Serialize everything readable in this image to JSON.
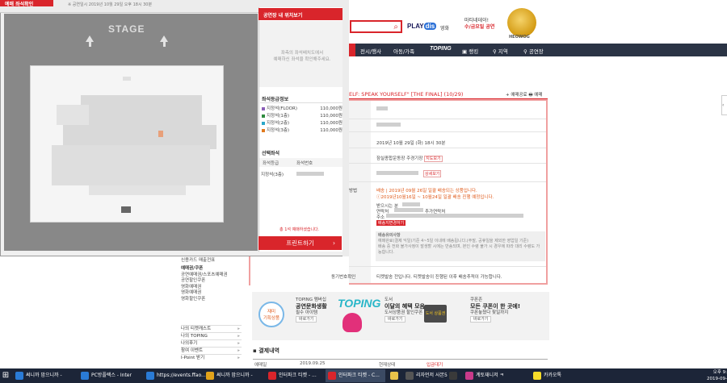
{
  "site": {
    "top_links": {
      "play": "PLAY",
      "play_badge": "dis",
      "movie": "영화"
    },
    "promo": {
      "line1": "마티네데이!",
      "line2": "수/금요일 공연"
    },
    "emblem_label": "HEOWOG",
    "nav": [
      "전시/행사",
      "아동/가족",
      "TOPING",
      "랭킹",
      "지역",
      "공연장"
    ],
    "show_title": "ELF: SPEAK YOURSELF\" [THE FINAL] (10/29)",
    "title_actions": "+ 예매공료  🖶 예매",
    "info": {
      "date": "2019년 10월 29일 (화)  18시 30분",
      "venue": "잠실종합운동장 주경기장",
      "venue_btn": "지도보기",
      "detail_btn": "상세보기",
      "delivery_label": "방법",
      "delivery_line1": "배송 | 2019년 09월 26일 일괄 배송되는 상품입니다.",
      "delivery_line2": "ⓘ2019년10월16일 ~ 10월24일 일괄 배송 진행 예정입니다.",
      "recv_label": "받으시는 분",
      "contact_label": "연락처",
      "extra_contact": "추가연락처",
      "address_label": "주소",
      "change_btn": "배송지변경하기",
      "note_title": "배송유의사항",
      "note_line1": "예매완료(결제 익일)기준 4~5일 이내에 배송됩니다.(주말, 공휴일을 제외한 영업일 기준)",
      "note_line2": "배송 중 전화 불가사정이 발생할 시에는 반송되며, 본인 수령 불가 시 경우에 따라 대리 수령도 가능합니다.",
      "ticket_label": "동기번호확인",
      "ticket_text": "티켓발송 전입니다. 티켓발송이 진행된 이후 배송추적이 가능합니다."
    },
    "sidebar_lower": {
      "items_a": [
        "현금영수증",
        "신용카드 매출전표"
      ],
      "coupon_head": "예매권/쿠폰",
      "coupons": [
        "공연예매권/스포츠예매권",
        "공연할인쿠폰",
        "영화예매권",
        "영화예매권",
        "영화할인쿠폰"
      ],
      "menu": [
        "나의 티켓캐스트",
        "나의 TOPING",
        "나의후기",
        "참여 이벤트",
        "I-Point 받기"
      ]
    },
    "banner": {
      "badge_line1": "재미",
      "badge_line2": "기획상품",
      "toping_small": "TOPING 멤버십",
      "toping_big": "공연문화생활",
      "toping_sub": "필수 아이템",
      "toping_logo": "TOPING",
      "doseo_small": "도서",
      "doseo_big": "이달의 혜택 모음",
      "doseo_sub": "도서상품권 할인쿠폰",
      "doseo_card": "도서 상품권",
      "coupon_small": "쿠폰존",
      "coupon_big": "모든 쿠폰이 한 곳에!",
      "coupon_sub": "쿠폰놓쳤다 찾일까지",
      "more": "바로가기"
    },
    "payment": {
      "heading": "결제내역",
      "col1": "예매일",
      "val1": "2019.09.25",
      "col2": "현재상태",
      "val2": "입금대기"
    }
  },
  "popup": {
    "header_red": "예매 좌석확인",
    "subhead": "※ 공연일시 2019년 10월 29일 오후 18시 30분",
    "stage": "STAGE",
    "right_panel": {
      "head": "공연장 내 위치보기",
      "map_msg_line1": "좌측의 좌석배치도에서",
      "map_msg_line2": "예매하신 좌석을 확인해주세요.",
      "grade_head": "좌석등급정보",
      "grades": [
        {
          "name": "지정석(FLOOR)",
          "price": "110,000원",
          "color": "#8b5fb8"
        },
        {
          "name": "지정석(1층)",
          "price": "110,000원",
          "color": "#2e8b3e"
        },
        {
          "name": "지정석(2층)",
          "price": "110,000원",
          "color": "#2aa7c9"
        },
        {
          "name": "지정석(3층)",
          "price": "110,000원",
          "color": "#e07a1e"
        }
      ],
      "selected_head": "선택좌석",
      "col_grade": "좌석등급",
      "col_seat": "좌석번호",
      "sel_grade": "지정석(3층)",
      "count": "총 1석 예매하셨습니다.",
      "print_btn": "프린트하기"
    }
  },
  "taskbar": {
    "items": [
      {
        "label": "써니까 맘으니까 -",
        "color": "#2a7bd6"
      },
      {
        "label": "PC방플렉스 - Inter",
        "color": "#2a7bd6"
      },
      {
        "label": "https://events.ffao...",
        "color": "#2a7bd6"
      },
      {
        "label": "써니까 맘으니까 -",
        "color": "#e2a21a"
      },
      {
        "label": "인터파크 티켓 - ...",
        "color": "#d9252b"
      },
      {
        "label": "인터파크 티켓 - C...",
        "color": "#d9252b"
      },
      {
        "label": "",
        "color": "#e8c24a"
      },
      {
        "label": "리자먼저 사본5",
        "color": "#555555"
      },
      {
        "label": "",
        "color": "#3a3a3a"
      },
      {
        "label": "계토재니저 ㅋ",
        "color": "#c93a8a"
      },
      {
        "label": "카카오톡",
        "color": "#f7dc2a"
      }
    ],
    "time": "오후 9:",
    "date": "2019-09-"
  }
}
